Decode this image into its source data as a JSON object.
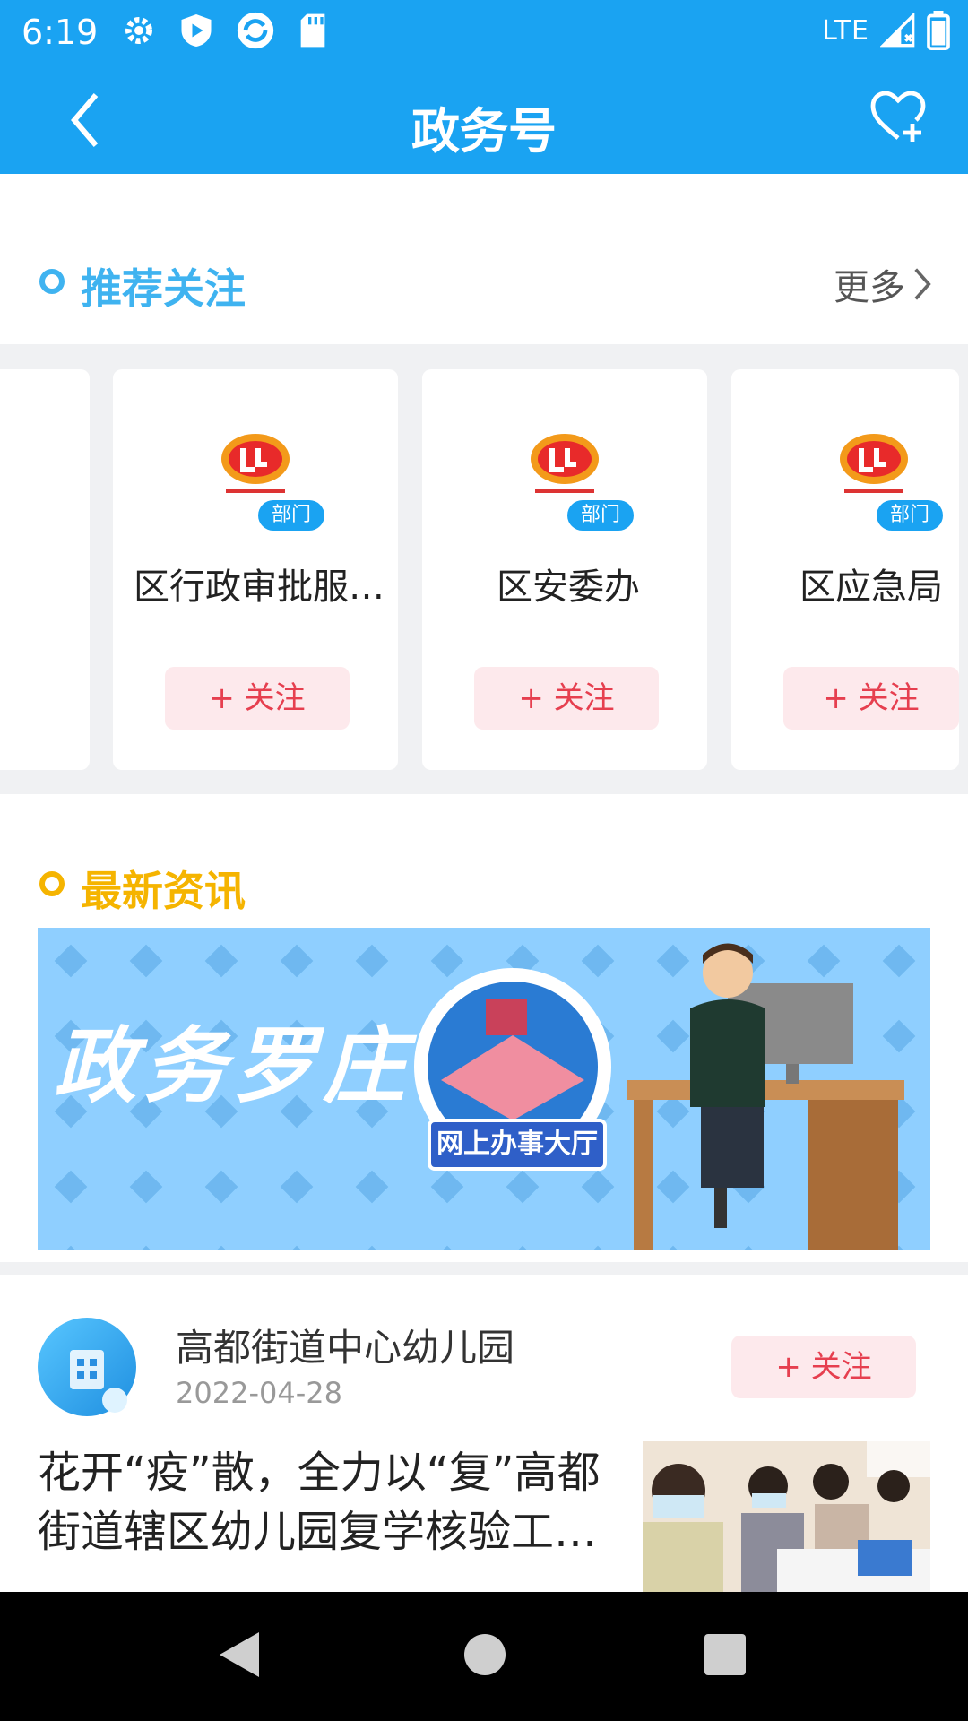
{
  "status_bar": {
    "time": "6:19",
    "network": "LTE",
    "icons": [
      "settings-icon",
      "shield-play-icon",
      "sync-icon",
      "sd-card-icon",
      "signal-icon",
      "battery-icon"
    ]
  },
  "header": {
    "title": "政务号",
    "back_icon": "back-icon",
    "fav_icon": "heart-plus-icon"
  },
  "recommend": {
    "title": "推荐关注",
    "more": "更多",
    "items": [
      {
        "badge": "部门",
        "name": "区行政审批服…",
        "follow": "+ 关注"
      },
      {
        "badge": "部门",
        "name": "区安委办",
        "follow": "+ 关注"
      },
      {
        "badge": "部门",
        "name": "区应急局",
        "follow": "+ 关注"
      }
    ]
  },
  "latest": {
    "title": "最新资讯",
    "banner": {
      "headline": "政务罗庄",
      "caption": "网上办事大厅"
    }
  },
  "news": {
    "source": "高都街道中心幼儿园",
    "date": "2022-04-28",
    "follow": "+ 关注",
    "title": "花开“疫”散，全力以“复”高都街道辖区幼儿园复学核验工…"
  },
  "colors": {
    "brand": "#1aa3f2",
    "follow_text": "#e63f4f",
    "follow_bg": "#fde9ec",
    "recommend_title": "#3fb3f0",
    "latest_title": "#f5b400"
  }
}
